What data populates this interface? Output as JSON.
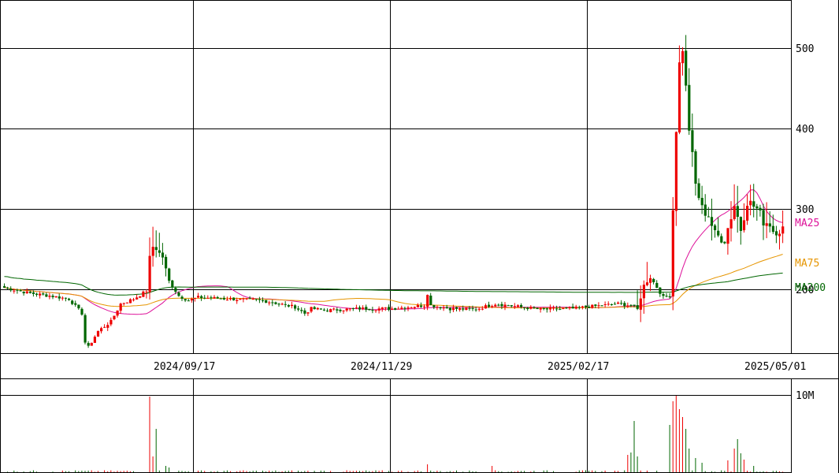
{
  "chart_data": {
    "type": "candlestick",
    "price_axis": {
      "ticks": [
        "200",
        "300",
        "400",
        "500"
      ],
      "tick_values": [
        200,
        300,
        400,
        500
      ],
      "range": [
        120,
        555
      ]
    },
    "date_axis": {
      "labels": [
        "2024/09/17",
        "2024/11/29",
        "2025/02/17",
        "2025/05/01"
      ]
    },
    "volume_axis": {
      "tick": "10M",
      "tick_value": 10000000,
      "range": [
        0,
        10000000
      ]
    },
    "moving_averages": [
      {
        "name": "MA25",
        "color": "#dd1199"
      },
      {
        "name": "MA75",
        "color": "#e69500"
      },
      {
        "name": "MA200",
        "color": "#006600"
      }
    ],
    "up_color": "#ee0000",
    "down_color": "#006600",
    "grid": true
  }
}
